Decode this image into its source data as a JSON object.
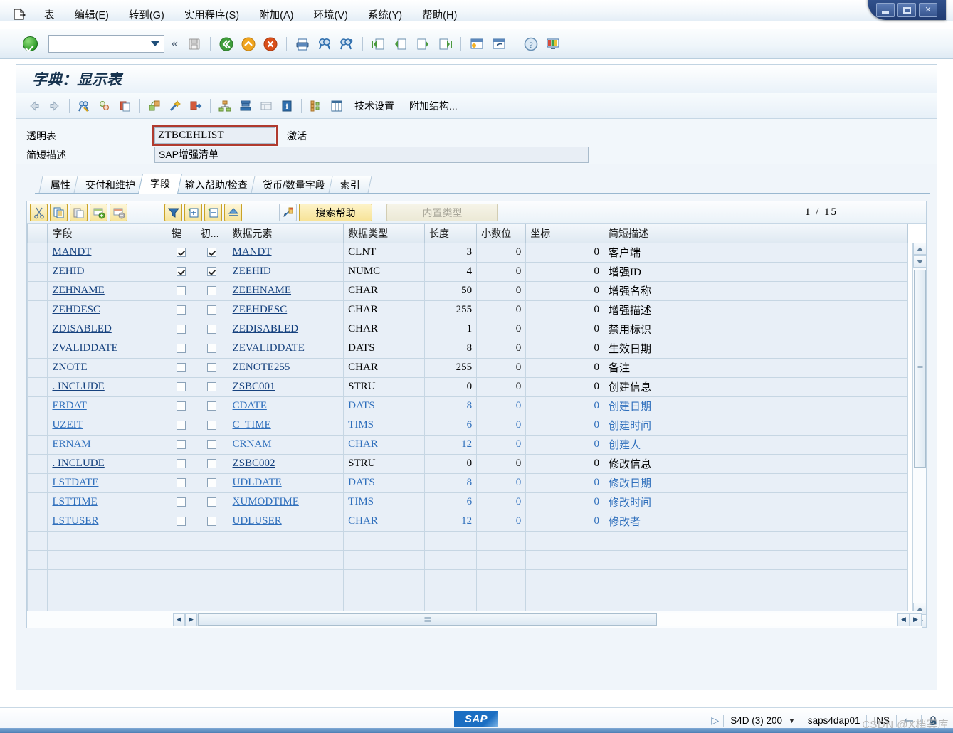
{
  "window": {
    "minimize_label": "minimize",
    "maximize_label": "maximize",
    "close_label": "✕"
  },
  "menubar": {
    "items": [
      {
        "label": "表"
      },
      {
        "label": "编辑(E)"
      },
      {
        "label": "转到(G)"
      },
      {
        "label": "实用程序(S)"
      },
      {
        "label": "附加(A)"
      },
      {
        "label": "环境(V)"
      },
      {
        "label": "系统(Y)"
      },
      {
        "label": "帮助(H)"
      }
    ]
  },
  "command_field": {
    "value": "",
    "placeholder": ""
  },
  "standard_toolbar": {
    "icons": [
      "enter-ok-icon",
      "save-icon",
      "back-green-icon",
      "exit-yellow-icon",
      "cancel-red-icon",
      "print-icon",
      "find-icon",
      "find-next-icon",
      "first-page-icon",
      "previous-page-icon",
      "next-page-icon",
      "last-page-icon",
      "create-session-icon",
      "create-shortcut-icon",
      "help-icon",
      "customize-layout-icon"
    ]
  },
  "screen": {
    "title": "字典：显示表"
  },
  "app_toolbar": {
    "icons": [
      "back-arrow-icon",
      "forward-arrow-icon",
      "display-change-icon",
      "check-icon",
      "copy-to-clipboard-icon",
      "activate-icon",
      "wand-icon",
      "forward-nav-icon",
      "hierarchy-icon",
      "stack-icon",
      "list-icon",
      "info-icon",
      "structure-icon",
      "columns-icon"
    ],
    "tech_settings_label": "技术设置",
    "append_structure_label": "附加结构..."
  },
  "form": {
    "table_label": "透明表",
    "table_value": "ZTBCEHLIST",
    "active_label": "激活",
    "desc_label": "简短描述",
    "desc_value": "SAP增强清单"
  },
  "tabs": [
    {
      "label": "属性",
      "active": false
    },
    {
      "label": "交付和维护",
      "active": false
    },
    {
      "label": "字段",
      "active": true
    },
    {
      "label": "输入帮助/检查",
      "active": false
    },
    {
      "label": "货币/数量字段",
      "active": false
    },
    {
      "label": "索引",
      "active": false
    }
  ],
  "grid_toolbar": {
    "icons": [
      "cut-icon",
      "copy-icon",
      "paste-icon",
      "insert-row-icon",
      "delete-row-icon",
      "filter-icon",
      "expand-include-icon",
      "collapse-include-icon",
      "predefined-type-up-icon",
      "data-element-jump-icon"
    ],
    "search_help_label": "搜索帮助",
    "builtin_type_label": "内置类型",
    "page_current": "1",
    "page_separator": "/",
    "page_total": "15"
  },
  "table": {
    "columns": [
      {
        "key": "field",
        "label": "字段"
      },
      {
        "key": "key",
        "label": "键"
      },
      {
        "key": "init",
        "label": "初..."
      },
      {
        "key": "data_element",
        "label": "数据元素"
      },
      {
        "key": "data_type",
        "label": "数据类型"
      },
      {
        "key": "length",
        "label": "长度"
      },
      {
        "key": "decimals",
        "label": "小数位"
      },
      {
        "key": "coord",
        "label": "坐标"
      },
      {
        "key": "short_desc",
        "label": "简短描述"
      }
    ],
    "rows": [
      {
        "field": "MANDT",
        "key": true,
        "init": true,
        "data_element": "MANDT",
        "data_type": "CLNT",
        "length": "3",
        "decimals": "0",
        "coord": "0",
        "short_desc": "客户端",
        "style": "dark",
        "field_link": true,
        "de_link": true
      },
      {
        "field": "ZEHID",
        "key": true,
        "init": true,
        "data_element": "ZEEHID",
        "data_type": "NUMC",
        "length": "4",
        "decimals": "0",
        "coord": "0",
        "short_desc": "增强ID",
        "style": "dark",
        "field_link": true,
        "de_link": true
      },
      {
        "field": "ZEHNAME",
        "key": false,
        "init": false,
        "data_element": "ZEEHNAME",
        "data_type": "CHAR",
        "length": "50",
        "decimals": "0",
        "coord": "0",
        "short_desc": "增强名称",
        "style": "dark",
        "field_link": true,
        "de_link": true
      },
      {
        "field": "ZEHDESC",
        "key": false,
        "init": false,
        "data_element": "ZEEHDESC",
        "data_type": "CHAR",
        "length": "255",
        "decimals": "0",
        "coord": "0",
        "short_desc": "增强描述",
        "style": "dark",
        "field_link": true,
        "de_link": true
      },
      {
        "field": "ZDISABLED",
        "key": false,
        "init": false,
        "data_element": "ZEDISABLED",
        "data_type": "CHAR",
        "length": "1",
        "decimals": "0",
        "coord": "0",
        "short_desc": "禁用标识",
        "style": "dark",
        "field_link": true,
        "de_link": true
      },
      {
        "field": "ZVALIDDATE",
        "key": false,
        "init": false,
        "data_element": "ZEVALIDDATE",
        "data_type": "DATS",
        "length": "8",
        "decimals": "0",
        "coord": "0",
        "short_desc": "生效日期",
        "style": "dark",
        "field_link": true,
        "de_link": true
      },
      {
        "field": "ZNOTE",
        "key": false,
        "init": false,
        "data_element": "ZENOTE255",
        "data_type": "CHAR",
        "length": "255",
        "decimals": "0",
        "coord": "0",
        "short_desc": "备注",
        "style": "dark",
        "field_link": true,
        "de_link": true
      },
      {
        "field": ". INCLUDE",
        "key": false,
        "init": false,
        "data_element": "ZSBC001",
        "data_type": "STRU",
        "length": "0",
        "decimals": "0",
        "coord": "0",
        "short_desc": "创建信息",
        "style": "dark",
        "field_link": true,
        "de_link": true
      },
      {
        "field": "ERDAT",
        "key": false,
        "init": false,
        "data_element": "CDATE",
        "data_type": "DATS",
        "length": "8",
        "decimals": "0",
        "coord": "0",
        "short_desc": "创建日期",
        "style": "blue",
        "field_link": true,
        "de_link": true
      },
      {
        "field": "UZEIT",
        "key": false,
        "init": false,
        "data_element": "C_TIME",
        "data_type": "TIMS",
        "length": "6",
        "decimals": "0",
        "coord": "0",
        "short_desc": "创建时间",
        "style": "blue",
        "field_link": true,
        "de_link": true
      },
      {
        "field": "ERNAM",
        "key": false,
        "init": false,
        "data_element": "CRNAM",
        "data_type": "CHAR",
        "length": "12",
        "decimals": "0",
        "coord": "0",
        "short_desc": "创建人",
        "style": "blue",
        "field_link": true,
        "de_link": true
      },
      {
        "field": ". INCLUDE",
        "key": false,
        "init": false,
        "data_element": "ZSBC002",
        "data_type": "STRU",
        "length": "0",
        "decimals": "0",
        "coord": "0",
        "short_desc": "修改信息",
        "style": "dark",
        "field_link": true,
        "de_link": true
      },
      {
        "field": "LSTDATE",
        "key": false,
        "init": false,
        "data_element": "UDLDATE",
        "data_type": "DATS",
        "length": "8",
        "decimals": "0",
        "coord": "0",
        "short_desc": "修改日期",
        "style": "blue",
        "field_link": true,
        "de_link": true
      },
      {
        "field": "LSTTIME",
        "key": false,
        "init": false,
        "data_element": "XUMODTIME",
        "data_type": "TIMS",
        "length": "6",
        "decimals": "0",
        "coord": "0",
        "short_desc": "修改时间",
        "style": "blue",
        "field_link": true,
        "de_link": true
      },
      {
        "field": "LSTUSER",
        "key": false,
        "init": false,
        "data_element": "UDLUSER",
        "data_type": "CHAR",
        "length": "12",
        "decimals": "0",
        "coord": "0",
        "short_desc": "修改者",
        "style": "blue",
        "field_link": true,
        "de_link": true
      }
    ],
    "empty_row_count": 5
  },
  "statusbar": {
    "logo_text": "SAP",
    "system": "S4D (3) 200",
    "server": "saps4dap01",
    "mode": "INS",
    "watermark": "CSDN @X档案库"
  },
  "colors": {
    "accent_blue": "#1b6ec2",
    "link": "#15417e",
    "link_blue": "#2f6fbc",
    "row_bg": "#e8eff7",
    "header_bg": "#dfe9f2",
    "toolbar_yellow": "#f7e398",
    "focus_red": "#b03a2e"
  }
}
